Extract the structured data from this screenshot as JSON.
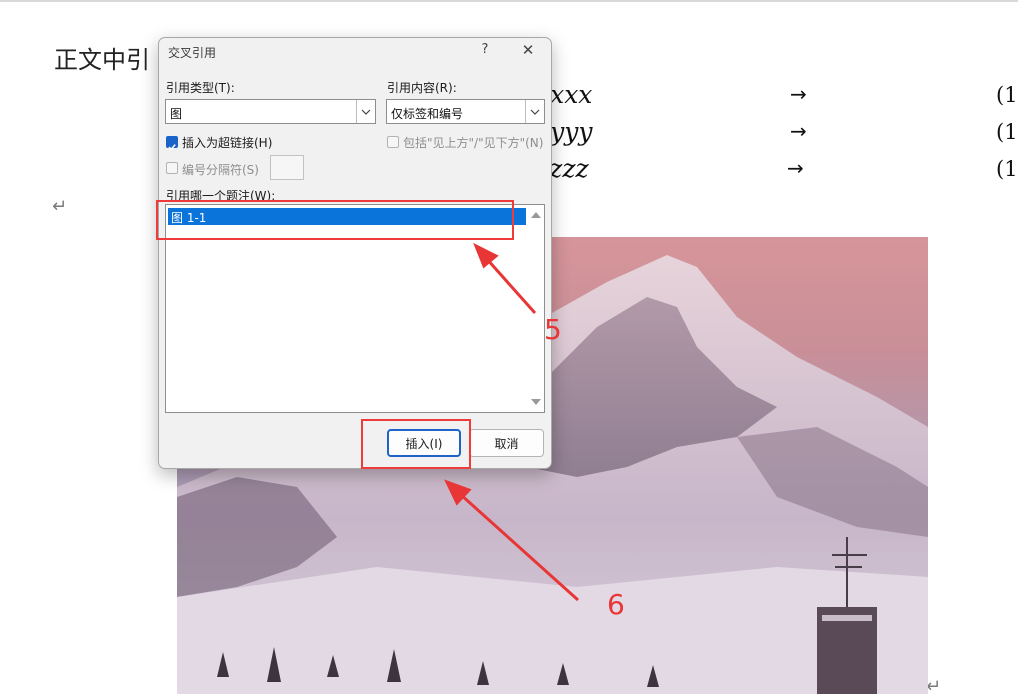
{
  "document": {
    "body_text": "正文中引",
    "equations": [
      {
        "expr": "xxxx",
        "arrow": "→",
        "number": "(1"
      },
      {
        "expr": "yyyy",
        "arrow": "→",
        "number": "(1"
      },
      {
        "expr": "zzzz",
        "arrow": "→",
        "number": "(1"
      }
    ],
    "paragraph_mark": "↵"
  },
  "dialog": {
    "title": "交叉引用",
    "help": "?",
    "close": "✕",
    "ref_type_label": "引用类型(T):",
    "ref_type_value": "图",
    "ref_content_label": "引用内容(R):",
    "ref_content_value": "仅标签和编号",
    "insert_hyperlink_label": "插入为超链接(H)",
    "insert_hyperlink_checked": true,
    "include_above_below_label": "包括\"见上方\"/\"见下方\"(N)",
    "include_above_below_checked": false,
    "separate_numbers_label": "编号分隔符(S)",
    "separate_numbers_checked": false,
    "which_caption_label": "引用哪一个题注(W):",
    "captions": [
      "图 1-1"
    ],
    "insert_button": "插入(I)",
    "cancel_button": "取消"
  },
  "annotations": {
    "step5": "5",
    "step6": "6",
    "color": "#e83636"
  }
}
